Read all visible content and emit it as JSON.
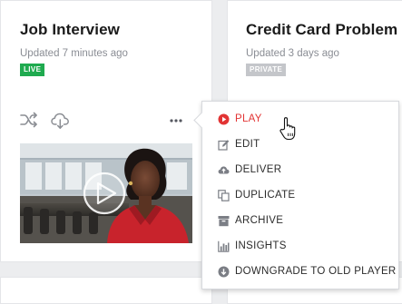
{
  "cards": [
    {
      "title": "Job Interview",
      "updated": "Updated 7 minutes ago",
      "status": "LIVE",
      "status_color": "#1faa4f"
    },
    {
      "title": "Credit Card Problem",
      "updated": "Updated 3 days ago",
      "status": "PRIVATE",
      "status_color": "#c4c6ca"
    }
  ],
  "card_tools": {
    "icons": [
      "shuffle-icon",
      "cloud-download-icon",
      "more-dots-icon"
    ]
  },
  "menu": {
    "items": [
      {
        "label": "PLAY",
        "icon": "play-circle-icon",
        "active": true
      },
      {
        "label": "EDIT",
        "icon": "edit-icon"
      },
      {
        "label": "DELIVER",
        "icon": "cloud-upload-icon"
      },
      {
        "label": "DUPLICATE",
        "icon": "duplicate-icon"
      },
      {
        "label": "ARCHIVE",
        "icon": "archive-icon"
      },
      {
        "label": "INSIGHTS",
        "icon": "bar-chart-icon"
      },
      {
        "label": "DOWNGRADE TO OLD PLAYER",
        "icon": "download-circle-icon"
      }
    ]
  },
  "colors": {
    "accent_red": "#e23434",
    "icon_gray": "#8b8e94",
    "live_green": "#1faa4f",
    "private_gray": "#c4c6ca"
  }
}
